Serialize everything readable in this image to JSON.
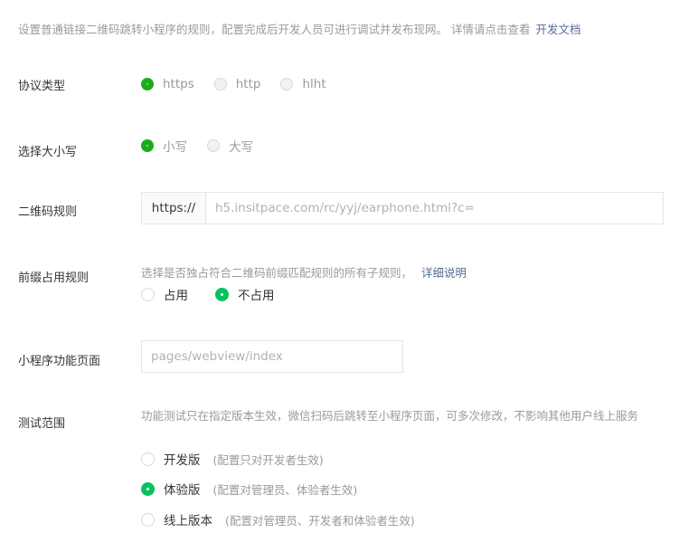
{
  "intro": {
    "text": "设置普通链接二维码跳转小程序的规则，配置完成后开发人员可进行调试并发布现网。 详情请点击查看",
    "link": "开发文档"
  },
  "protocol": {
    "label": "协议类型",
    "options": [
      "https",
      "http",
      "hlht"
    ],
    "selected": "https"
  },
  "case": {
    "label": "选择大小写",
    "options": [
      "小写",
      "大写"
    ],
    "selected": "小写"
  },
  "qr_rule": {
    "label": "二维码规则",
    "prefix": "https://",
    "value": "h5.insitpace.com/rc/yyj/earphone.html?c="
  },
  "prefix_rule": {
    "label": "前缀占用规则",
    "hint": "选择是否独占符合二维码前缀匹配规则的所有子规则，",
    "hint_link": "详细说明",
    "options": [
      "占用",
      "不占用"
    ],
    "selected": "不占用"
  },
  "mini_page": {
    "label": "小程序功能页面",
    "placeholder": "pages/webview/index"
  },
  "test_scope": {
    "label": "测试范围",
    "description": "功能测试只在指定版本生效，微信扫码后跳转至小程序页面，可多次修改，不影响其他用户线上服务",
    "options": [
      {
        "label": "开发版",
        "note": "(配置只对开发者生效)"
      },
      {
        "label": "体验版",
        "note": "(配置对管理员、体验者生效)"
      },
      {
        "label": "线上版本",
        "note": "(配置对管理员、开发者和体验者生效)"
      }
    ],
    "selected": "体验版"
  },
  "colors": {
    "primary_green": "#1aad19",
    "bright_green": "#07c160",
    "link_blue": "#576b95",
    "muted_text": "#9a9a9a"
  }
}
